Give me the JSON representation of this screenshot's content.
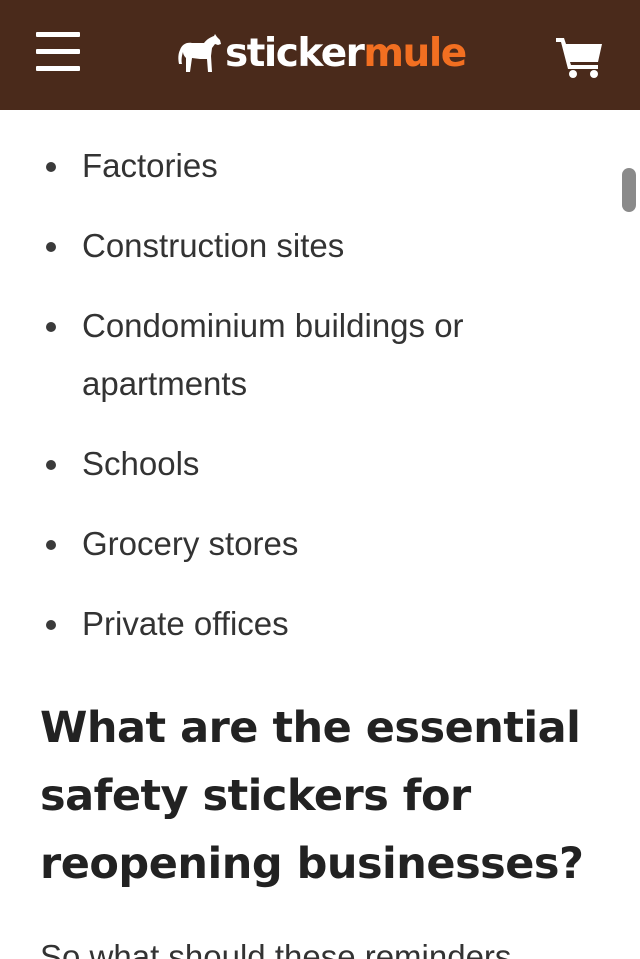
{
  "header": {
    "menu_icon": "hamburger-menu-icon",
    "logo": {
      "icon": "mule-icon",
      "text_part1": "sticker",
      "text_part2": "mule",
      "color_part1": "#ffffff",
      "color_part2": "#f26f21"
    },
    "cart_icon": "shopping-cart-icon",
    "background": "#4a2a1b"
  },
  "content": {
    "bullets": [
      "Factories",
      "Construction sites",
      "Condominium buildings or apartments",
      "Schools",
      "Grocery stores",
      "Private offices"
    ],
    "heading": "What are the essential safety stickers for reopening businesses?",
    "paragraph": "So what should these reminders"
  }
}
